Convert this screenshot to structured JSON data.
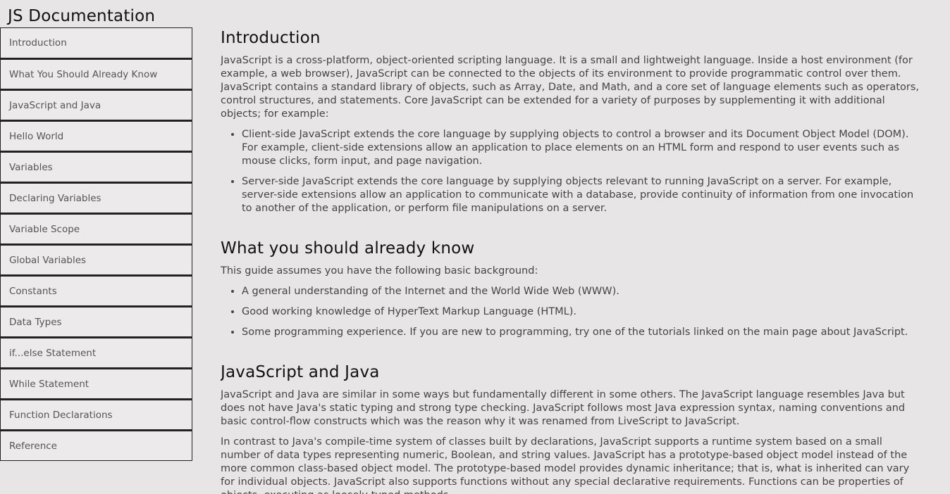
{
  "navbar": {
    "title": "JS Documentation",
    "items": [
      {
        "label": "Introduction"
      },
      {
        "label": "What You Should Already Know"
      },
      {
        "label": "JavaScript and Java"
      },
      {
        "label": "Hello World"
      },
      {
        "label": "Variables"
      },
      {
        "label": "Declaring Variables"
      },
      {
        "label": "Variable Scope"
      },
      {
        "label": "Global Variables"
      },
      {
        "label": "Constants"
      },
      {
        "label": "Data Types"
      },
      {
        "label": "if...else Statement"
      },
      {
        "label": "While Statement"
      },
      {
        "label": "Function Declarations"
      },
      {
        "label": "Reference"
      }
    ]
  },
  "sections": {
    "introduction": {
      "title": "Introduction",
      "paragraph": "JavaScript is a cross-platform, object-oriented scripting language. It is a small and lightweight language. Inside a host environment (for example, a web browser), JavaScript can be connected to the objects of its environment to provide programmatic control over them. JavaScript contains a standard library of objects, such as Array, Date, and Math, and a core set of language elements such as operators, control structures, and statements. Core JavaScript can be extended for a variety of purposes by supplementing it with additional objects; for example:",
      "bullets": [
        "Client-side JavaScript extends the core language by supplying objects to control a browser and its Document Object Model (DOM). For example, client-side extensions allow an application to place elements on an HTML form and respond to user events such as mouse clicks, form input, and page navigation.",
        "Server-side JavaScript extends the core language by supplying objects relevant to running JavaScript on a server. For example, server-side extensions allow an application to communicate with a database, provide continuity of information from one invocation to another of the application, or perform file manipulations on a server."
      ]
    },
    "already_know": {
      "title": "What you should already know",
      "paragraph": "This guide assumes you have the following basic background:",
      "bullets": [
        "A general understanding of the Internet and the World Wide Web (WWW).",
        "Good working knowledge of HyperText Markup Language (HTML).",
        "Some programming experience. If you are new to programming, try one of the tutorials linked on the main page about JavaScript."
      ]
    },
    "js_and_java": {
      "title": "JavaScript and Java",
      "paragraph1": "JavaScript and Java are similar in some ways but fundamentally different in some others. The JavaScript language resembles Java but does not have Java's static typing and strong type checking. JavaScript follows most Java expression syntax, naming conventions and basic control-flow constructs which was the reason why it was renamed from LiveScript to JavaScript.",
      "paragraph2": "In contrast to Java's compile-time system of classes built by declarations, JavaScript supports a runtime system based on a small number of data types representing numeric, Boolean, and string values. JavaScript has a prototype-based object model instead of the more common class-based object model. The prototype-based model provides dynamic inheritance; that is, what is inherited can vary for individual objects. JavaScript also supports functions without any special declarative requirements. Functions can be properties of objects, executing as loosely typed methods."
    }
  }
}
